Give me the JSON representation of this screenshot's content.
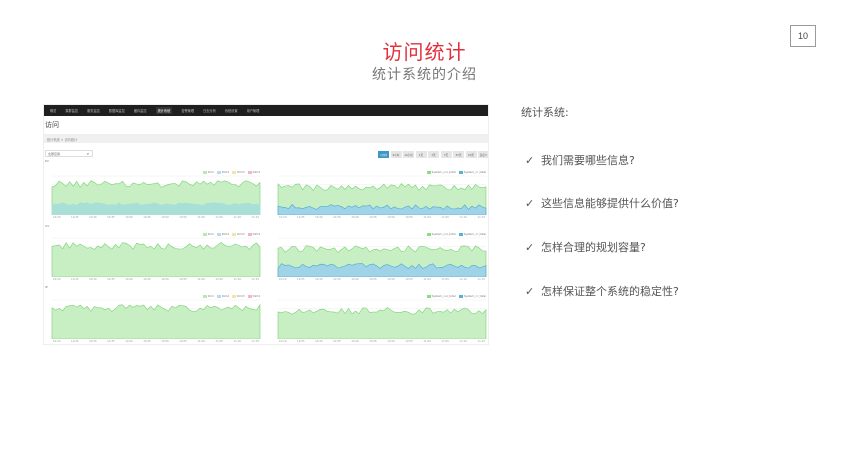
{
  "page_number": "10",
  "title": "访问统计",
  "subtitle": "统计系统的介绍",
  "section_heading": "统计系统:",
  "check_glyph": "✓",
  "points": [
    "我们需要哪些信息?",
    "这些信息能够提供什么价值?",
    "怎样合理的规划容量?",
    "怎样保证整个系统的稳定性?"
  ],
  "dashboard": {
    "nav_items": [
      "概览",
      "集群监控",
      "服务监控",
      "数据库监控",
      "缓存监控",
      "统计系统",
      "告警管理",
      "日志分析",
      "系统设置",
      "用户管理"
    ],
    "active_nav": 5,
    "page_title": "访问",
    "breadcrumb": "统计系统 > 访问统计",
    "select_value": "全部应用",
    "range_buttons": [
      "1小时",
      "6小时",
      "12小时",
      "1天",
      "3天",
      "7天",
      "30天",
      "90天",
      "自定义"
    ],
    "active_range": 0,
    "sections": [
      "PV",
      "UV",
      "IP"
    ],
    "x_ticks": [
      "10:20",
      "10:25",
      "10:30",
      "10:35",
      "10:40",
      "10:45",
      "10:50",
      "10:55",
      "11:00",
      "11:05",
      "11:10",
      "11:15"
    ],
    "legend_left": [
      {
        "label": "Dim",
        "color": "#b8e8b4"
      },
      {
        "label": "Dim2",
        "color": "#b7dcf2"
      },
      {
        "label": "Dim3",
        "color": "#f5e3b0"
      },
      {
        "label": "Dim4",
        "color": "#f2b8c0"
      }
    ],
    "legend_right": [
      {
        "label": "System_cur_total",
        "color": "#90d88a"
      },
      {
        "label": "System_cr_total",
        "color": "#5ab0d8"
      }
    ],
    "colors": {
      "fill_green": "#c8efc4",
      "line_green": "#7bd074",
      "fill_blue": "#9fd3e8",
      "line_blue": "#4aa8cf",
      "fill_teal": "#a8e0d8"
    }
  }
}
